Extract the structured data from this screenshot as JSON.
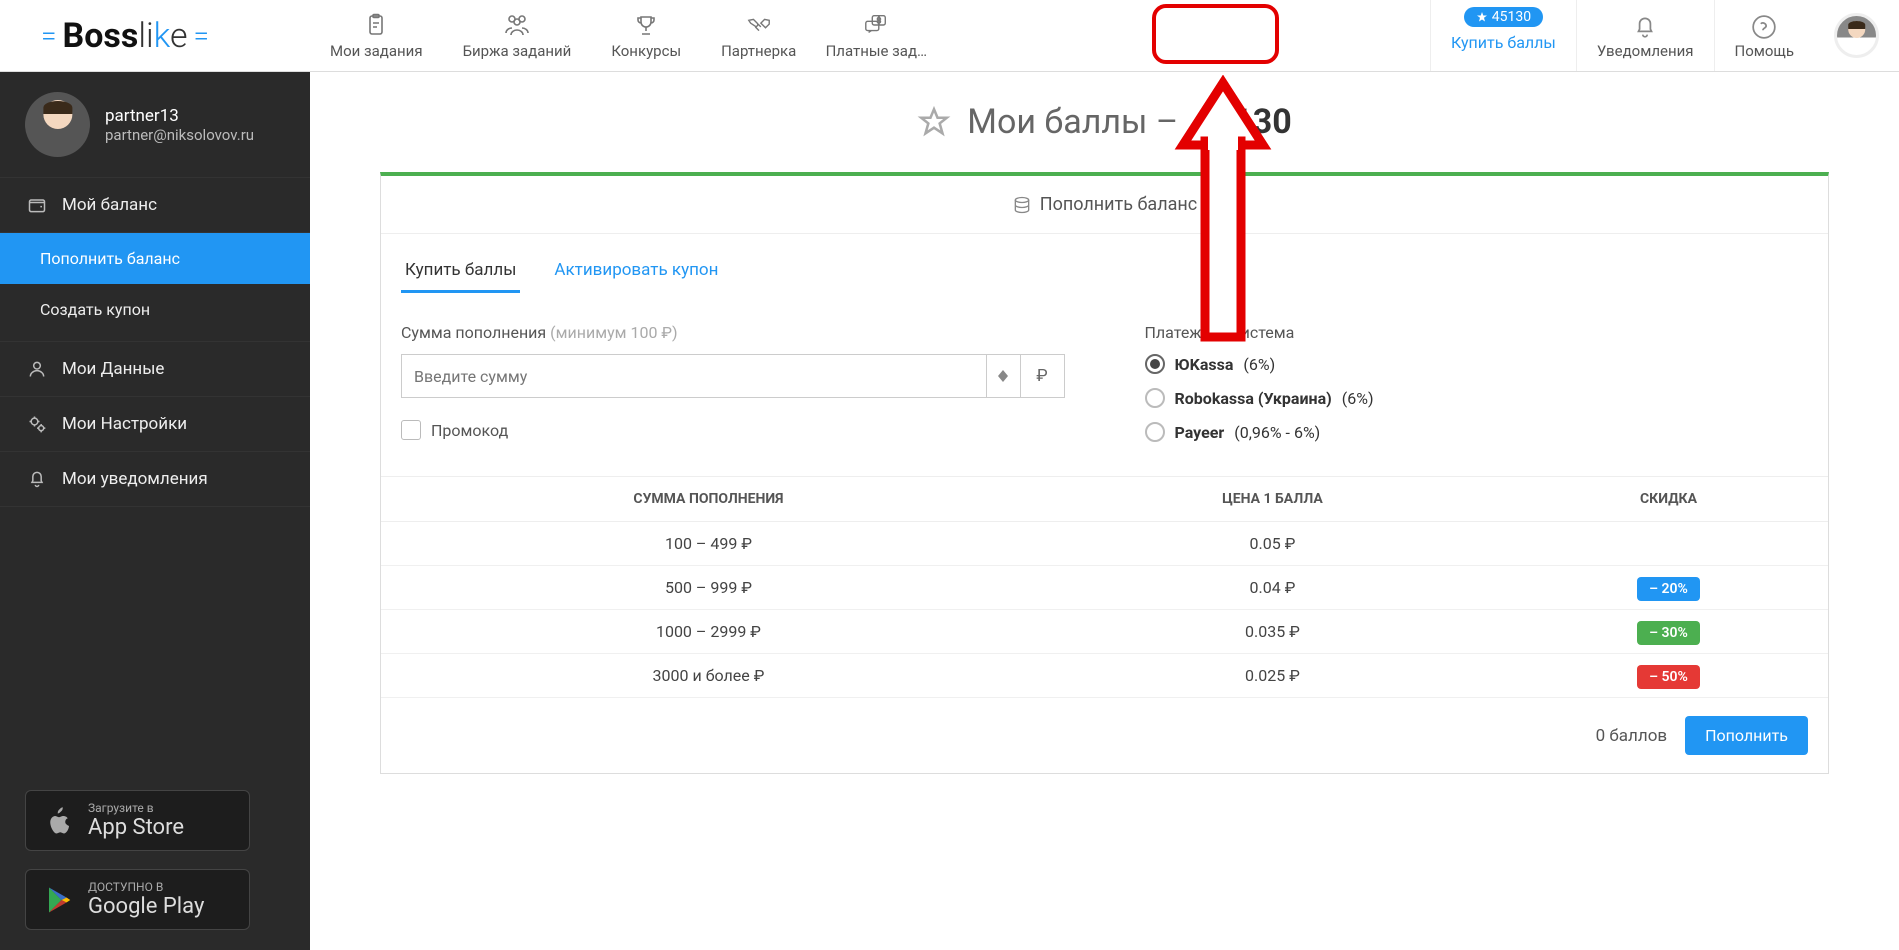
{
  "logo": {
    "prefix": "Boss",
    "suffix": "li",
    "k": "k",
    "e": "e"
  },
  "topnav": [
    {
      "label": "Мои задания"
    },
    {
      "label": "Биржа заданий"
    },
    {
      "label": "Конкурсы"
    },
    {
      "label": "Партнерка"
    },
    {
      "label": "Платные зад…"
    }
  ],
  "header_right": {
    "balance": "45130",
    "buy_label": "Купить баллы",
    "notifications": "Уведомления",
    "help": "Помощь"
  },
  "user": {
    "name": "partner13",
    "email": "partner@niksolovov.ru"
  },
  "sidebar": {
    "balance": "Мой баланс",
    "topup": "Пополнить баланс",
    "coupon": "Создать купон",
    "mydata": "Мои Данные",
    "settings": "Мои Настройки",
    "notifs": "Мои уведомления",
    "appstore_pre": "Загрузите в",
    "appstore": "App Store",
    "google_pre": "ДОСТУПНО В",
    "google": "Google Play"
  },
  "page": {
    "title_prefix": "Мои баллы –",
    "title_value": "45130",
    "card_head": "Пополнить баланс",
    "tab_buy": "Купить баллы",
    "tab_coupon": "Активировать купон",
    "sum_label": "Сумма пополнения",
    "sum_hint": "(минимум 100 ₽)",
    "sum_placeholder": "Введите сумму",
    "rub": "₽",
    "promo": "Промокод",
    "paysys": "Платежная система",
    "pays": [
      {
        "label": "ЮKassa",
        "fee": "(6%)"
      },
      {
        "label": "Robokassa (Украина)",
        "fee": "(6%)"
      },
      {
        "label": "Payeer",
        "fee": "(0,96% - 6%)"
      }
    ],
    "thead": [
      "СУММА ПОПОЛНЕНИЯ",
      "ЦЕНА 1 БАЛЛА",
      "СКИДКА"
    ],
    "rows": [
      {
        "range": "100 – 499 ₽",
        "price": "0.05 ₽",
        "disc": "",
        "cls": ""
      },
      {
        "range": "500 – 999 ₽",
        "price": "0.04 ₽",
        "disc": "– 20%",
        "cls": "dblue"
      },
      {
        "range": "1000 – 2999 ₽",
        "price": "0.035 ₽",
        "disc": "– 30%",
        "cls": "dgreen"
      },
      {
        "range": "3000 и более ₽",
        "price": "0.025 ₽",
        "disc": "– 50%",
        "cls": "dred"
      }
    ],
    "footer_pts": "0 баллов",
    "footer_btn": "Пополнить"
  }
}
